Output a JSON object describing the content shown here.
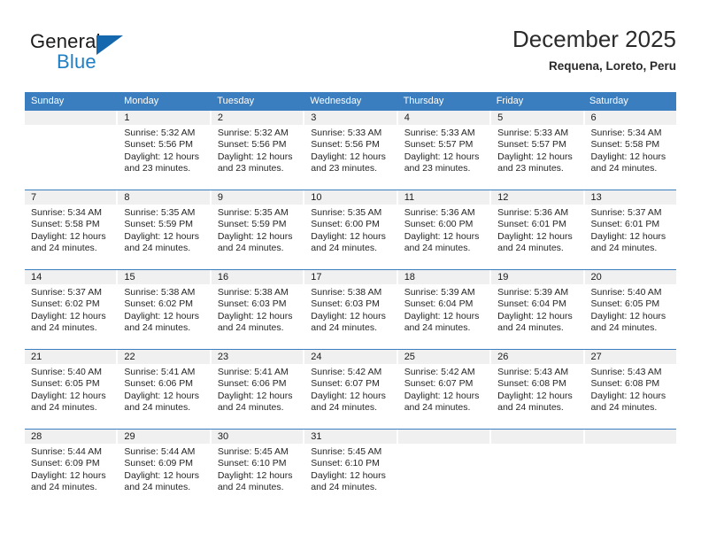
{
  "logo": {
    "primary_text": "General",
    "secondary_text": "Blue",
    "primary_color": "#1b1b1b",
    "secondary_color": "#1f7fc4",
    "triangle_color": "#1567ae"
  },
  "header": {
    "title": "December 2025",
    "subtitle": "Requena, Loreto, Peru"
  },
  "theme": {
    "header_row_bg": "#3a7ebf",
    "header_row_text": "#ffffff",
    "daynum_bg": "#f0f0f0",
    "row_divider": "#3a7ebf",
    "page_bg": "#ffffff"
  },
  "weekdays": [
    "Sunday",
    "Monday",
    "Tuesday",
    "Wednesday",
    "Thursday",
    "Friday",
    "Saturday"
  ],
  "labels": {
    "sunrise_prefix": "Sunrise:",
    "sunset_prefix": "Sunset:",
    "daylight_prefix": "Daylight:"
  },
  "weeks": [
    [
      {
        "day": "",
        "sunrise": "",
        "sunset": "",
        "daylight_line1": "",
        "daylight_line2": ""
      },
      {
        "day": "1",
        "sunrise": "Sunrise: 5:32 AM",
        "sunset": "Sunset: 5:56 PM",
        "daylight_line1": "Daylight: 12 hours",
        "daylight_line2": "and 23 minutes."
      },
      {
        "day": "2",
        "sunrise": "Sunrise: 5:32 AM",
        "sunset": "Sunset: 5:56 PM",
        "daylight_line1": "Daylight: 12 hours",
        "daylight_line2": "and 23 minutes."
      },
      {
        "day": "3",
        "sunrise": "Sunrise: 5:33 AM",
        "sunset": "Sunset: 5:56 PM",
        "daylight_line1": "Daylight: 12 hours",
        "daylight_line2": "and 23 minutes."
      },
      {
        "day": "4",
        "sunrise": "Sunrise: 5:33 AM",
        "sunset": "Sunset: 5:57 PM",
        "daylight_line1": "Daylight: 12 hours",
        "daylight_line2": "and 23 minutes."
      },
      {
        "day": "5",
        "sunrise": "Sunrise: 5:33 AM",
        "sunset": "Sunset: 5:57 PM",
        "daylight_line1": "Daylight: 12 hours",
        "daylight_line2": "and 23 minutes."
      },
      {
        "day": "6",
        "sunrise": "Sunrise: 5:34 AM",
        "sunset": "Sunset: 5:58 PM",
        "daylight_line1": "Daylight: 12 hours",
        "daylight_line2": "and 24 minutes."
      }
    ],
    [
      {
        "day": "7",
        "sunrise": "Sunrise: 5:34 AM",
        "sunset": "Sunset: 5:58 PM",
        "daylight_line1": "Daylight: 12 hours",
        "daylight_line2": "and 24 minutes."
      },
      {
        "day": "8",
        "sunrise": "Sunrise: 5:35 AM",
        "sunset": "Sunset: 5:59 PM",
        "daylight_line1": "Daylight: 12 hours",
        "daylight_line2": "and 24 minutes."
      },
      {
        "day": "9",
        "sunrise": "Sunrise: 5:35 AM",
        "sunset": "Sunset: 5:59 PM",
        "daylight_line1": "Daylight: 12 hours",
        "daylight_line2": "and 24 minutes."
      },
      {
        "day": "10",
        "sunrise": "Sunrise: 5:35 AM",
        "sunset": "Sunset: 6:00 PM",
        "daylight_line1": "Daylight: 12 hours",
        "daylight_line2": "and 24 minutes."
      },
      {
        "day": "11",
        "sunrise": "Sunrise: 5:36 AM",
        "sunset": "Sunset: 6:00 PM",
        "daylight_line1": "Daylight: 12 hours",
        "daylight_line2": "and 24 minutes."
      },
      {
        "day": "12",
        "sunrise": "Sunrise: 5:36 AM",
        "sunset": "Sunset: 6:01 PM",
        "daylight_line1": "Daylight: 12 hours",
        "daylight_line2": "and 24 minutes."
      },
      {
        "day": "13",
        "sunrise": "Sunrise: 5:37 AM",
        "sunset": "Sunset: 6:01 PM",
        "daylight_line1": "Daylight: 12 hours",
        "daylight_line2": "and 24 minutes."
      }
    ],
    [
      {
        "day": "14",
        "sunrise": "Sunrise: 5:37 AM",
        "sunset": "Sunset: 6:02 PM",
        "daylight_line1": "Daylight: 12 hours",
        "daylight_line2": "and 24 minutes."
      },
      {
        "day": "15",
        "sunrise": "Sunrise: 5:38 AM",
        "sunset": "Sunset: 6:02 PM",
        "daylight_line1": "Daylight: 12 hours",
        "daylight_line2": "and 24 minutes."
      },
      {
        "day": "16",
        "sunrise": "Sunrise: 5:38 AM",
        "sunset": "Sunset: 6:03 PM",
        "daylight_line1": "Daylight: 12 hours",
        "daylight_line2": "and 24 minutes."
      },
      {
        "day": "17",
        "sunrise": "Sunrise: 5:38 AM",
        "sunset": "Sunset: 6:03 PM",
        "daylight_line1": "Daylight: 12 hours",
        "daylight_line2": "and 24 minutes."
      },
      {
        "day": "18",
        "sunrise": "Sunrise: 5:39 AM",
        "sunset": "Sunset: 6:04 PM",
        "daylight_line1": "Daylight: 12 hours",
        "daylight_line2": "and 24 minutes."
      },
      {
        "day": "19",
        "sunrise": "Sunrise: 5:39 AM",
        "sunset": "Sunset: 6:04 PM",
        "daylight_line1": "Daylight: 12 hours",
        "daylight_line2": "and 24 minutes."
      },
      {
        "day": "20",
        "sunrise": "Sunrise: 5:40 AM",
        "sunset": "Sunset: 6:05 PM",
        "daylight_line1": "Daylight: 12 hours",
        "daylight_line2": "and 24 minutes."
      }
    ],
    [
      {
        "day": "21",
        "sunrise": "Sunrise: 5:40 AM",
        "sunset": "Sunset: 6:05 PM",
        "daylight_line1": "Daylight: 12 hours",
        "daylight_line2": "and 24 minutes."
      },
      {
        "day": "22",
        "sunrise": "Sunrise: 5:41 AM",
        "sunset": "Sunset: 6:06 PM",
        "daylight_line1": "Daylight: 12 hours",
        "daylight_line2": "and 24 minutes."
      },
      {
        "day": "23",
        "sunrise": "Sunrise: 5:41 AM",
        "sunset": "Sunset: 6:06 PM",
        "daylight_line1": "Daylight: 12 hours",
        "daylight_line2": "and 24 minutes."
      },
      {
        "day": "24",
        "sunrise": "Sunrise: 5:42 AM",
        "sunset": "Sunset: 6:07 PM",
        "daylight_line1": "Daylight: 12 hours",
        "daylight_line2": "and 24 minutes."
      },
      {
        "day": "25",
        "sunrise": "Sunrise: 5:42 AM",
        "sunset": "Sunset: 6:07 PM",
        "daylight_line1": "Daylight: 12 hours",
        "daylight_line2": "and 24 minutes."
      },
      {
        "day": "26",
        "sunrise": "Sunrise: 5:43 AM",
        "sunset": "Sunset: 6:08 PM",
        "daylight_line1": "Daylight: 12 hours",
        "daylight_line2": "and 24 minutes."
      },
      {
        "day": "27",
        "sunrise": "Sunrise: 5:43 AM",
        "sunset": "Sunset: 6:08 PM",
        "daylight_line1": "Daylight: 12 hours",
        "daylight_line2": "and 24 minutes."
      }
    ],
    [
      {
        "day": "28",
        "sunrise": "Sunrise: 5:44 AM",
        "sunset": "Sunset: 6:09 PM",
        "daylight_line1": "Daylight: 12 hours",
        "daylight_line2": "and 24 minutes."
      },
      {
        "day": "29",
        "sunrise": "Sunrise: 5:44 AM",
        "sunset": "Sunset: 6:09 PM",
        "daylight_line1": "Daylight: 12 hours",
        "daylight_line2": "and 24 minutes."
      },
      {
        "day": "30",
        "sunrise": "Sunrise: 5:45 AM",
        "sunset": "Sunset: 6:10 PM",
        "daylight_line1": "Daylight: 12 hours",
        "daylight_line2": "and 24 minutes."
      },
      {
        "day": "31",
        "sunrise": "Sunrise: 5:45 AM",
        "sunset": "Sunset: 6:10 PM",
        "daylight_line1": "Daylight: 12 hours",
        "daylight_line2": "and 24 minutes."
      },
      {
        "day": "",
        "sunrise": "",
        "sunset": "",
        "daylight_line1": "",
        "daylight_line2": ""
      },
      {
        "day": "",
        "sunrise": "",
        "sunset": "",
        "daylight_line1": "",
        "daylight_line2": ""
      },
      {
        "day": "",
        "sunrise": "",
        "sunset": "",
        "daylight_line1": "",
        "daylight_line2": ""
      }
    ]
  ]
}
